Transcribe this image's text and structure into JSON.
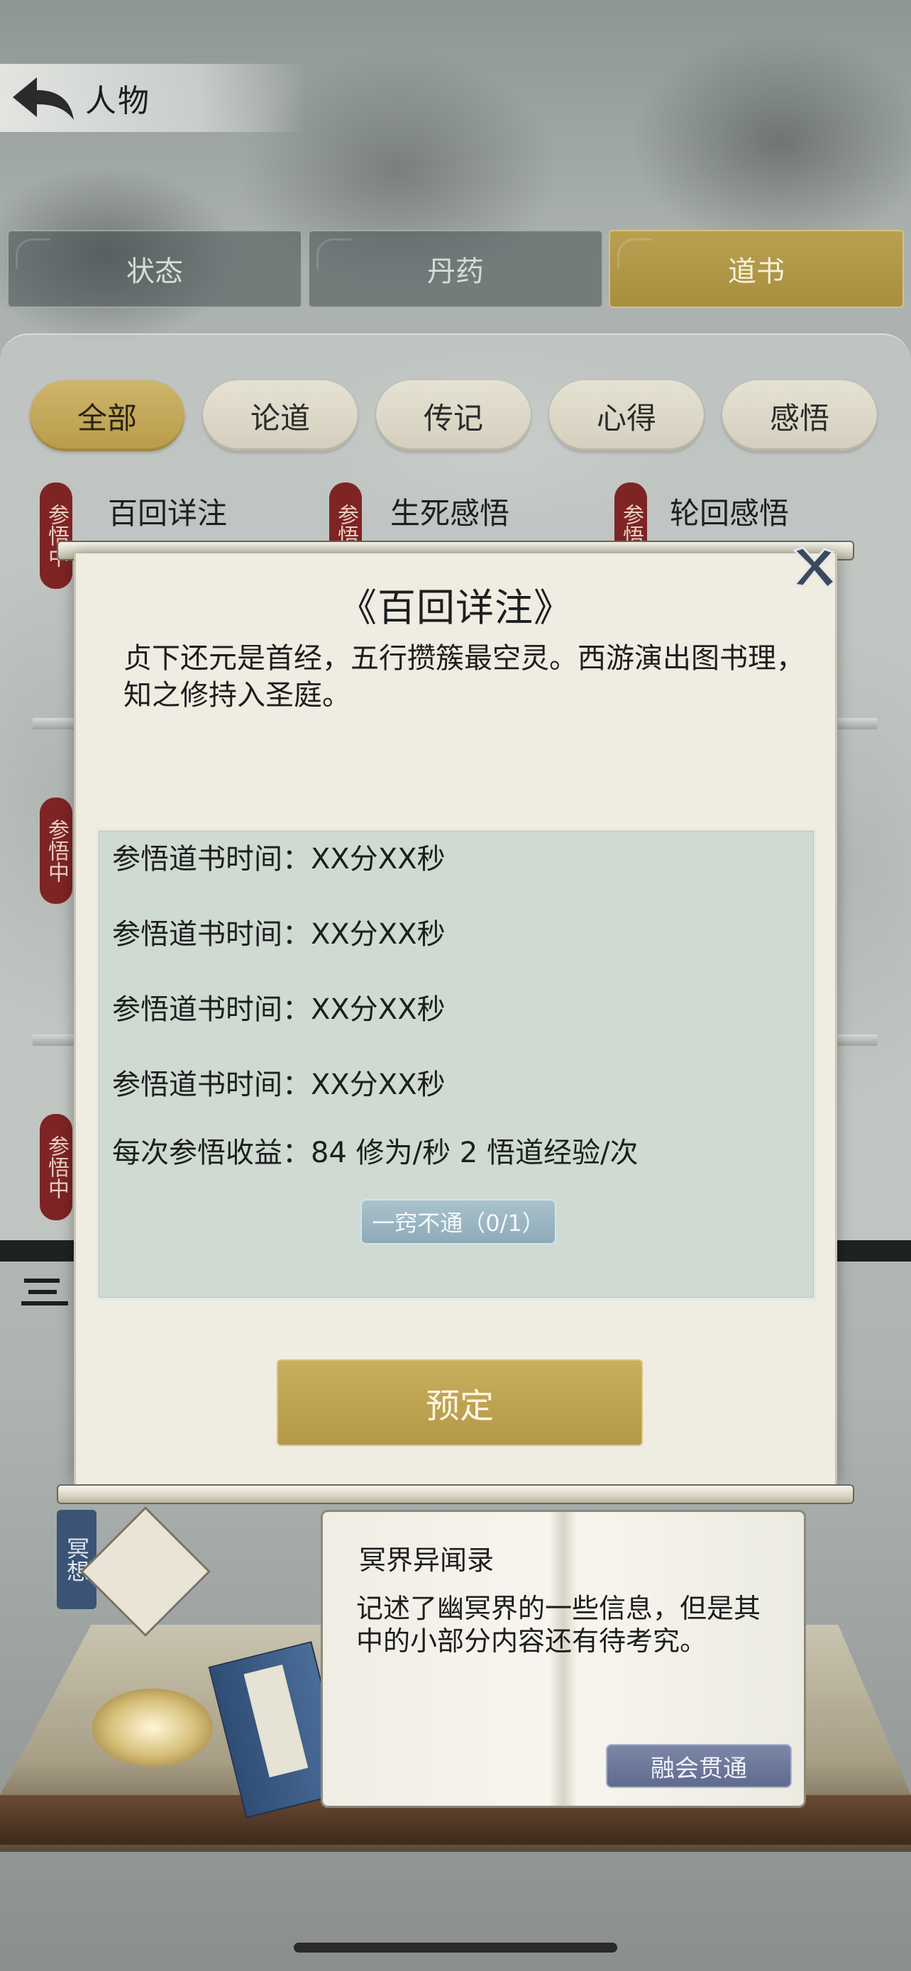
{
  "header": {
    "title": "人物"
  },
  "main_tabs": [
    {
      "label": "状态",
      "active": false
    },
    {
      "label": "丹药",
      "active": false
    },
    {
      "label": "道书",
      "active": true
    }
  ],
  "filters": [
    {
      "label": "全部",
      "active": true
    },
    {
      "label": "论道",
      "active": false
    },
    {
      "label": "传记",
      "active": false
    },
    {
      "label": "心得",
      "active": false
    },
    {
      "label": "感悟",
      "active": false
    }
  ],
  "book_list": {
    "seal_label": "参悟中",
    "row1": [
      "百回详注",
      "生死感悟",
      "轮回感悟"
    ]
  },
  "dialog": {
    "title": "《百回详注》",
    "description": "贞下还元是首经，五行攒簇最空灵。西游演出图书理，知之修持入圣庭。",
    "info_lines": [
      "参悟道书时间：XX分XX秒",
      "参悟道书时间：XX分XX秒",
      "参悟道书时间：XX分XX秒",
      "参悟道书时间：XX分XX秒",
      "每次参悟收益：84 修为/秒 2 悟道经验/次"
    ],
    "badge": "一窍不通（0/1）",
    "button": "预定"
  },
  "bottom": {
    "meditate_tag": "冥想",
    "book_title": "冥界异闻录",
    "book_description": "记述了幽冥界的一些信息，但是其中的小部分内容还有待考究。",
    "master_button": "融会贯通"
  },
  "colors": {
    "gold": "#b99c4a",
    "seal_red": "#7e2424",
    "info_box": "#cfdad3",
    "dialog_bg": "#efece2"
  }
}
